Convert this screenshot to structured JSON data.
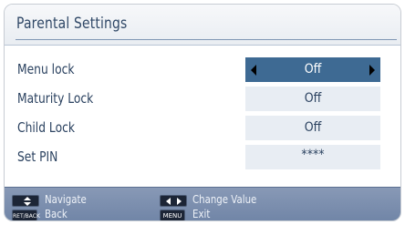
{
  "title": "Parental Settings",
  "rows": [
    {
      "label": "Menu lock",
      "value": "Off"
    },
    {
      "label": "Maturity Lock",
      "value": "Off"
    },
    {
      "label": "Child Lock",
      "value": "Off"
    },
    {
      "label": "Set PIN",
      "value": "****"
    }
  ],
  "footer": {
    "navigate_label": "Navigate",
    "change_value_label": "Change Value",
    "back_label": "Back",
    "back_key": "RET/BACK",
    "exit_label": "Exit",
    "menu_key": "MENU"
  },
  "colors": {
    "selected_value_bg": "#3e6a93",
    "value_bg": "#e8edf3",
    "footer_bg": "#7a8eae",
    "text": "#2b4260"
  },
  "icons": [
    "up-down-arrows-icon",
    "left-right-arrows-icon",
    "left-arrow-icon",
    "right-arrow-icon"
  ]
}
